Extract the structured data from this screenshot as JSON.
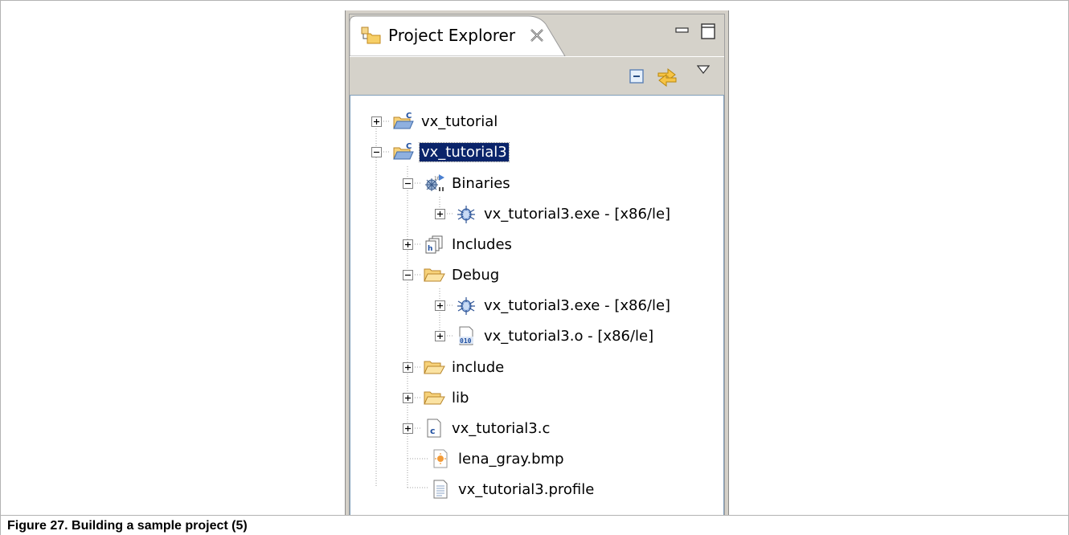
{
  "view": {
    "title": "Project Explorer",
    "tab_icon": "project-explorer-icon",
    "close_icon": "close-icon",
    "minimize_icon": "minimize-icon",
    "maximize_icon": "maximize-icon"
  },
  "toolbar": {
    "collapse_icon": "collapse-all-icon",
    "link_icon": "link-with-editor-icon",
    "menu_icon": "view-menu-icon"
  },
  "tree": {
    "items": [
      {
        "label": "vx_tutorial",
        "icon": "c-project-folder-icon",
        "expanded": false,
        "selected": false
      },
      {
        "label": "vx_tutorial3",
        "icon": "c-project-folder-icon",
        "expanded": true,
        "selected": true
      },
      {
        "label": "Binaries",
        "icon": "binaries-icon",
        "expanded": true
      },
      {
        "label": "vx_tutorial3.exe - [x86/le]",
        "icon": "bug-executable-icon",
        "expanded": false
      },
      {
        "label": "Includes",
        "icon": "includes-icon",
        "expanded": false
      },
      {
        "label": "Debug",
        "icon": "folder-open-icon",
        "expanded": true
      },
      {
        "label": "vx_tutorial3.exe - [x86/le]",
        "icon": "bug-executable-icon",
        "expanded": false
      },
      {
        "label": "vx_tutorial3.o - [x86/le]",
        "icon": "object-file-icon",
        "expanded": false
      },
      {
        "label": "include",
        "icon": "folder-icon",
        "expanded": false
      },
      {
        "label": "lib",
        "icon": "folder-icon",
        "expanded": false
      },
      {
        "label": "vx_tutorial3.c",
        "icon": "c-source-file-icon",
        "expanded": false
      },
      {
        "label": "lena_gray.bmp",
        "icon": "image-file-icon"
      },
      {
        "label": "vx_tutorial3.profile",
        "icon": "text-file-icon"
      }
    ]
  },
  "caption": "Figure 27.  Building a sample project (5)",
  "colors": {
    "selection": "#0a246a",
    "panel_bg": "#d5d2ca",
    "folder": "#f5c451"
  }
}
